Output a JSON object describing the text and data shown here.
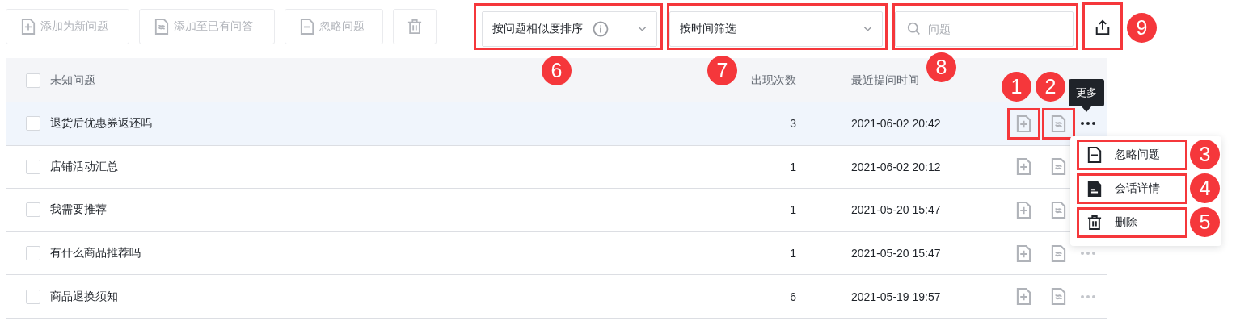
{
  "toolbar": {
    "buttons": [
      {
        "kind": "add",
        "label": "添加为新问题",
        "disabled": true
      },
      {
        "kind": "link",
        "label": "添加至已有问答",
        "disabled": true
      },
      {
        "kind": "ignore",
        "label": "忽略问题",
        "disabled": true
      },
      {
        "kind": "delete",
        "disabled": true
      }
    ],
    "sort_select": {
      "value": "按问题相似度排序",
      "callout": "6"
    },
    "time_filter": {
      "value": "按时间筛选",
      "callout": "7"
    },
    "search": {
      "placeholder": "问题",
      "callout": "8"
    },
    "export": {
      "callout": "9"
    }
  },
  "table": {
    "header": {
      "checked": false,
      "columns": [
        "未知问题",
        "出现次数",
        "最近提问时间"
      ]
    },
    "rows": [
      {
        "question": "退货后优惠券返还吗",
        "count": "3",
        "time": "2021-06-02 20:42",
        "checked": false,
        "hovered": true,
        "more_visible": true,
        "callouts": [
          "1",
          "2"
        ],
        "tooltip": "更多",
        "menu": [
          {
            "kind": "ignore",
            "label": "忽略问题",
            "callout": "3"
          },
          {
            "kind": "details",
            "label": "会话详情",
            "callout": "4"
          },
          {
            "kind": "delete",
            "label": "删除",
            "callout": "5"
          }
        ]
      },
      {
        "question": "店铺活动汇总",
        "count": "1",
        "time": "2021-06-02 20:12",
        "checked": false,
        "hovered": false,
        "more_visible": false
      },
      {
        "question": "我需要推荐",
        "count": "1",
        "time": "2021-05-20 15:47",
        "checked": false,
        "hovered": false,
        "more_visible": false
      },
      {
        "question": "有什么商品推荐吗",
        "count": "1",
        "time": "2021-05-20 15:47",
        "checked": false,
        "hovered": false,
        "more_visible": true
      },
      {
        "question": "商品退换须知",
        "count": "6",
        "time": "2021-05-19 19:57",
        "checked": false,
        "hovered": false,
        "more_visible": true
      }
    ]
  }
}
